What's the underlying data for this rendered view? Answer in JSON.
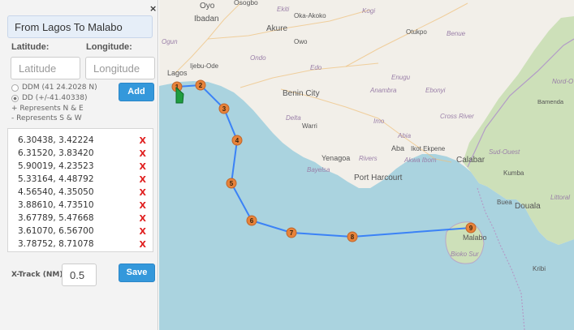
{
  "panel": {
    "close_icon": "×",
    "title": "From Lagos To Malabo",
    "latitude_label": "Latitude:",
    "longitude_label": "Longitude:",
    "latitude_placeholder": "Latitude",
    "longitude_placeholder": "Longitude",
    "ddm_option": "DDM (41 24.2028 N)",
    "dd_option": "DD (+/-41.40338)",
    "note_positive": "+ Represents N & E",
    "note_negative": "- Represents S & W",
    "add_label": "Add",
    "xtrack_label": "X-Track (NM)",
    "xtrack_value": "0.5",
    "save_label": "Save",
    "delete_icon": "X",
    "coordinates": [
      "6.30438, 3.42224",
      "6.31520, 3.83420",
      "5.90019, 4.23523",
      "5.33164, 4.48792",
      "4.56540, 4.35050",
      "3.88610, 4.73510",
      "3.67789, 5.47668",
      "3.61070, 6.56700",
      "3.78752, 8.71078"
    ]
  },
  "map": {
    "colors": {
      "water": "#aad3df",
      "land": "#f2efe9",
      "forest": "#cde0b9",
      "route": "#3b82f6",
      "marker": "#e8833a"
    },
    "waypoints": [
      "1",
      "2",
      "3",
      "4",
      "5",
      "6",
      "7",
      "8",
      "9"
    ],
    "labels": {
      "oyo": "Oyo",
      "osogbo": "Osogbo",
      "ekiti": "Ekiti",
      "ibadan": "Ibadan",
      "oka": "Oka-Akoko",
      "kogi": "Kogi",
      "akure": "Akure",
      "owo": "Owo",
      "otukpo": "Otukpo",
      "benue": "Benue",
      "ogun": "Ogun",
      "ondo": "Ondo",
      "ijebu": "Ijebu-Ode",
      "edo": "Edo",
      "lagos": "Lagos",
      "enugu": "Enugu",
      "anambra": "Anambra",
      "ebonyi": "Ebonyi",
      "benin": "Benin City",
      "nord": "Nord-O",
      "bamenda": "Bamenda",
      "delta": "Delta",
      "crossriver": "Cross River",
      "warri": "Warri",
      "imo": "Imo",
      "abia": "Abia",
      "sudouest": "Sud-Ouest",
      "aba": "Aba",
      "ikotekpene": "Ikot Ekpene",
      "calabar": "Calabar",
      "yenagoa": "Yenagoa",
      "rivers": "Rivers",
      "akwaibom": "Akwa Ibom",
      "bayelsa": "Bayelsa",
      "kumba": "Kumba",
      "porthar": "Port Harcourt",
      "buea": "Buea",
      "douala": "Douala",
      "littoral": "Littoral",
      "malabo": "Malabo",
      "biokosur": "Bioko Sur",
      "kribi": "Kribi"
    }
  }
}
